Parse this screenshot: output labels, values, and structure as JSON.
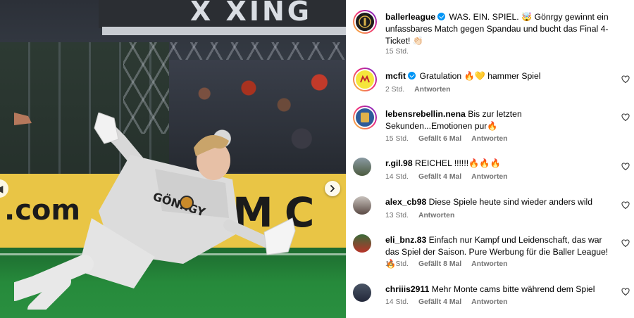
{
  "photo": {
    "roof_text": "X XING",
    "banner_left_text": ".com",
    "banner_right_text": "M C",
    "jersey_text": "GÖNRGY"
  },
  "post": {
    "username": "ballerleague",
    "verified": true,
    "caption": "WAS. EIN. SPIEL. 🤯 Gönrgy gewinnt ein unfassbares Match gegen Spandau und bucht das Final 4-Ticket! 👏🏻",
    "time": "15 Std."
  },
  "comments": [
    {
      "username": "mcfit",
      "verified": true,
      "text": "Gratulation 🔥💛 hammer Spiel",
      "time": "2 Std.",
      "likes": "",
      "reply": "Antworten"
    },
    {
      "username": "lebensrebellin.nena",
      "verified": false,
      "text": "Bis zur letzten Sekunden...Emotionen pur🔥",
      "time": "15 Std.",
      "likes": "Gefällt 6 Mal",
      "reply": "Antworten"
    },
    {
      "username": "r.gil.98",
      "verified": false,
      "text": "REICHEL !!!!!!🔥🔥🔥",
      "time": "14 Std.",
      "likes": "Gefällt 4 Mal",
      "reply": "Antworten"
    },
    {
      "username": "alex_cb98",
      "verified": false,
      "text": "Diese Spiele heute sind wieder anders wild",
      "time": "13 Std.",
      "likes": "",
      "reply": "Antworten"
    },
    {
      "username": "eli_bnz.83",
      "verified": false,
      "text": "Einfach nur Kampf und Leidenschaft, das war das Spiel der Saison. Pure Werbung für die Baller League! 🔥",
      "time": "15 Std.",
      "likes": "Gefällt 8 Mal",
      "reply": "Antworten"
    },
    {
      "username": "chriiis2911",
      "verified": false,
      "text": "Mehr Monte cams bitte während dem Spiel",
      "time": "14 Std.",
      "likes": "Gefällt 4 Mal",
      "reply": "Antworten"
    }
  ],
  "colors": {
    "verified": "#0095f6",
    "meta_text": "#737373",
    "banner": "#e9c545",
    "pitch": "#268a3b"
  },
  "icons": {
    "heart": "heart-icon",
    "next": "chevron-right-icon",
    "verified": "verified-badge-icon"
  }
}
